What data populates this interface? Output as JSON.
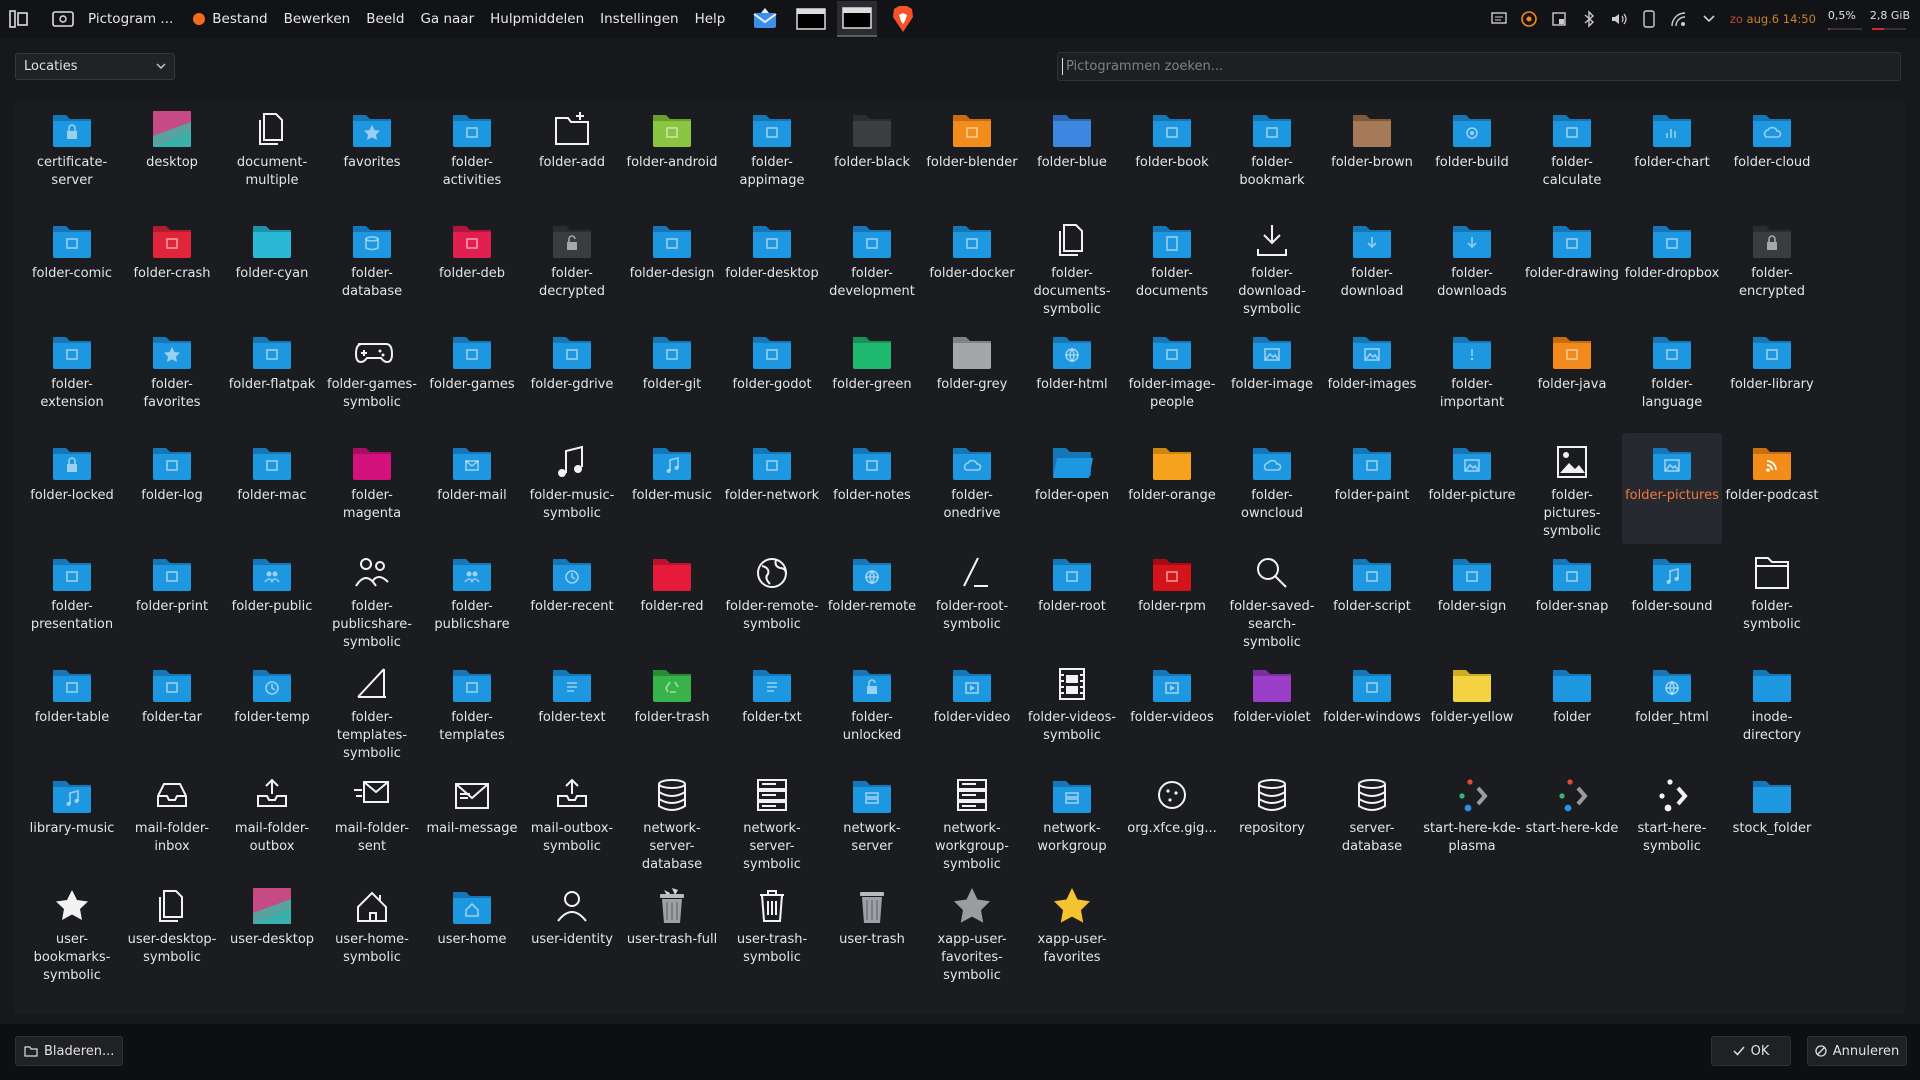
{
  "colors": {
    "folder_blue": "#1d97e0",
    "folder_blue_tab": "#1577b8",
    "accent": "#f2773a",
    "panel": "#121316",
    "dialog": "#16181c"
  },
  "topbar": {
    "app_title": "Pictogram ...",
    "menus": [
      "Bestand",
      "Bewerken",
      "Beeld",
      "Ga naar",
      "Hulpmiddelen",
      "Instellingen",
      "Help"
    ],
    "clock": {
      "prefix": "zo",
      "date_time": "aug.6 14:50"
    },
    "stats": {
      "cpu": "0,5%",
      "mem": "2,8 GiB",
      "cpu_fraction": 0.005,
      "mem_fraction": 0.35
    },
    "tray_icons": [
      "notes-icon",
      "updates-icon",
      "clipboard-icon",
      "bluetooth-icon",
      "volume-icon",
      "phone-icon",
      "network-icon",
      "expand-icon"
    ]
  },
  "dialog": {
    "locations_label": "Locaties",
    "search_placeholder": "Pictogrammen zoeken...",
    "browse_label": "Bladeren...",
    "ok_label": "OK",
    "cancel_label": "Annuleren"
  },
  "icons": [
    {
      "name": "certificate-server",
      "type": "folder",
      "glyph": "lock"
    },
    {
      "name": "desktop",
      "type": "desktop"
    },
    {
      "name": "document-multiple",
      "type": "mono",
      "glyph": "docs"
    },
    {
      "name": "favorites",
      "type": "folder",
      "glyph": "star"
    },
    {
      "name": "folder-activities",
      "type": "folder",
      "glyph": "act"
    },
    {
      "name": "folder-add",
      "type": "mono",
      "glyph": "folderadd"
    },
    {
      "name": "folder-android",
      "type": "folder",
      "color": "#8ac541",
      "tab": "#6c9e2f",
      "glyph": "android"
    },
    {
      "name": "folder-appimage",
      "type": "folder",
      "glyph": "app"
    },
    {
      "name": "folder-black",
      "type": "folder",
      "color": "#3b3d41",
      "tab": "#2b2d31"
    },
    {
      "name": "folder-blender",
      "type": "folder",
      "color": "#f28d1c",
      "tab": "#c86e10",
      "glyph": "blender"
    },
    {
      "name": "folder-blue",
      "type": "folder",
      "color": "#3d87e0",
      "tab": "#2b69b8"
    },
    {
      "name": "folder-book",
      "type": "folder",
      "glyph": "book"
    },
    {
      "name": "folder-bookmark",
      "type": "folder",
      "glyph": "bookmark"
    },
    {
      "name": "folder-brown",
      "type": "folder",
      "color": "#a47a58",
      "tab": "#80593d"
    },
    {
      "name": "folder-build",
      "type": "folder",
      "glyph": "gear"
    },
    {
      "name": "folder-calculate",
      "type": "folder",
      "glyph": "calc"
    },
    {
      "name": "folder-chart",
      "type": "folder",
      "glyph": "chart"
    },
    {
      "name": "folder-cloud",
      "type": "folder",
      "glyph": "cloud"
    },
    {
      "name": "folder-comic",
      "type": "folder",
      "glyph": "comic"
    },
    {
      "name": "folder-crash",
      "type": "folder",
      "color": "#e0253b",
      "tab": "#b31b2e",
      "glyph": "crash"
    },
    {
      "name": "folder-cyan",
      "type": "folder",
      "color": "#29b9d6",
      "tab": "#1c93ac"
    },
    {
      "name": "folder-database",
      "type": "folder",
      "glyph": "db"
    },
    {
      "name": "folder-deb",
      "type": "folder",
      "color": "#e01e4f",
      "tab": "#b0163c",
      "glyph": "deb"
    },
    {
      "name": "folder-decrypted",
      "type": "folder",
      "color": "#3a3c40",
      "tab": "#2a2c30",
      "glyph": "unlock"
    },
    {
      "name": "folder-design",
      "type": "folder",
      "glyph": "design"
    },
    {
      "name": "folder-desktop",
      "type": "folder",
      "glyph": "monitor"
    },
    {
      "name": "folder-development",
      "type": "folder",
      "glyph": "code"
    },
    {
      "name": "folder-docker",
      "type": "folder",
      "glyph": "docker"
    },
    {
      "name": "folder-documents-symbolic",
      "type": "mono",
      "glyph": "docs"
    },
    {
      "name": "folder-documents",
      "type": "folder",
      "glyph": "doc"
    },
    {
      "name": "folder-download-symbolic",
      "type": "mono",
      "glyph": "download"
    },
    {
      "name": "folder-download",
      "type": "folder",
      "glyph": "download"
    },
    {
      "name": "folder-downloads",
      "type": "folder",
      "glyph": "download"
    },
    {
      "name": "folder-drawing",
      "type": "folder",
      "glyph": "drawing"
    },
    {
      "name": "folder-dropbox",
      "type": "folder",
      "glyph": "dropbox"
    },
    {
      "name": "folder-encrypted",
      "type": "folder",
      "color": "#3a3c40",
      "tab": "#2a2c30",
      "glyph": "lock"
    },
    {
      "name": "folder-extension",
      "type": "folder",
      "glyph": "ext"
    },
    {
      "name": "folder-favorites",
      "type": "folder",
      "glyph": "star"
    },
    {
      "name": "folder-flatpak",
      "type": "folder",
      "glyph": "box"
    },
    {
      "name": "folder-games-symbolic",
      "type": "mono",
      "glyph": "gamepad"
    },
    {
      "name": "folder-games",
      "type": "folder",
      "glyph": "gamepad"
    },
    {
      "name": "folder-gdrive",
      "type": "folder",
      "glyph": "gdrive"
    },
    {
      "name": "folder-git",
      "type": "folder",
      "glyph": "git"
    },
    {
      "name": "folder-godot",
      "type": "folder",
      "glyph": "godot"
    },
    {
      "name": "folder-green",
      "type": "folder",
      "color": "#1fb86f",
      "tab": "#16925a"
    },
    {
      "name": "folder-grey",
      "type": "folder",
      "color": "#a4a6aa",
      "tab": "#808286"
    },
    {
      "name": "folder-html",
      "type": "folder",
      "glyph": "globe"
    },
    {
      "name": "folder-image-people",
      "type": "folder",
      "glyph": "person"
    },
    {
      "name": "folder-image",
      "type": "folder",
      "glyph": "image"
    },
    {
      "name": "folder-images",
      "type": "folder",
      "glyph": "image"
    },
    {
      "name": "folder-important",
      "type": "folder",
      "glyph": "excl"
    },
    {
      "name": "folder-java",
      "type": "folder",
      "color": "#f28a1c",
      "tab": "#c76b0e",
      "glyph": "java"
    },
    {
      "name": "folder-language",
      "type": "folder",
      "glyph": "lang"
    },
    {
      "name": "folder-library",
      "type": "folder",
      "glyph": "library"
    },
    {
      "name": "folder-locked",
      "type": "folder",
      "glyph": "lock"
    },
    {
      "name": "folder-log",
      "type": "folder",
      "glyph": "log"
    },
    {
      "name": "folder-mac",
      "type": "folder",
      "glyph": "mac"
    },
    {
      "name": "folder-magenta",
      "type": "folder",
      "color": "#d4127e",
      "tab": "#a80c63"
    },
    {
      "name": "folder-mail",
      "type": "folder",
      "glyph": "mail"
    },
    {
      "name": "folder-music-symbolic",
      "type": "mono",
      "glyph": "music"
    },
    {
      "name": "folder-music",
      "type": "folder",
      "glyph": "music"
    },
    {
      "name": "folder-network",
      "type": "folder",
      "glyph": "net"
    },
    {
      "name": "folder-notes",
      "type": "folder",
      "glyph": "notes"
    },
    {
      "name": "folder-onedrive",
      "type": "folder",
      "glyph": "cloud"
    },
    {
      "name": "folder-open",
      "type": "folderopen",
      "color": "#1d97e0"
    },
    {
      "name": "folder-orange",
      "type": "folder",
      "color": "#f7a21e",
      "tab": "#cf8410"
    },
    {
      "name": "folder-owncloud",
      "type": "folder",
      "glyph": "cloud"
    },
    {
      "name": "folder-paint",
      "type": "folder",
      "glyph": "paint"
    },
    {
      "name": "folder-picture",
      "type": "folder",
      "glyph": "image"
    },
    {
      "name": "folder-pictures-symbolic",
      "type": "mono",
      "glyph": "picture"
    },
    {
      "name": "folder-pictures",
      "type": "folder",
      "glyph": "image",
      "selected": true
    },
    {
      "name": "folder-podcast",
      "type": "folder",
      "color": "#f28d1c",
      "tab": "#c86e10",
      "glyph": "rss"
    },
    {
      "name": "folder-presentation",
      "type": "folder",
      "glyph": "pres"
    },
    {
      "name": "folder-print",
      "type": "folder",
      "glyph": "print"
    },
    {
      "name": "folder-public",
      "type": "folder",
      "glyph": "people"
    },
    {
      "name": "folder-publicshare-symbolic",
      "type": "mono",
      "glyph": "people"
    },
    {
      "name": "folder-publicshare",
      "type": "folder",
      "glyph": "people"
    },
    {
      "name": "folder-recent",
      "type": "folder",
      "glyph": "clock"
    },
    {
      "name": "folder-red",
      "type": "folder",
      "color": "#e61a3a",
      "tab": "#b8122c"
    },
    {
      "name": "folder-remote-symbolic",
      "type": "mono",
      "glyph": "globe"
    },
    {
      "name": "folder-remote",
      "type": "folder",
      "glyph": "globe"
    },
    {
      "name": "folder-root-symbolic",
      "type": "mono",
      "glyph": "root"
    },
    {
      "name": "folder-root",
      "type": "folder",
      "glyph": "root"
    },
    {
      "name": "folder-rpm",
      "type": "folder",
      "color": "#d4131a",
      "tab": "#a80c12",
      "glyph": "rpm"
    },
    {
      "name": "folder-saved-search-symbolic",
      "type": "mono",
      "glyph": "search"
    },
    {
      "name": "folder-script",
      "type": "folder",
      "glyph": "script"
    },
    {
      "name": "folder-sign",
      "type": "folder",
      "glyph": "sign"
    },
    {
      "name": "folder-snap",
      "type": "folder",
      "glyph": "snap"
    },
    {
      "name": "folder-sound",
      "type": "folder",
      "glyph": "music"
    },
    {
      "name": "folder-symbolic",
      "type": "mono",
      "glyph": "folder"
    },
    {
      "name": "folder-table",
      "type": "folder",
      "glyph": "table"
    },
    {
      "name": "folder-tar",
      "type": "folder",
      "glyph": "tar"
    },
    {
      "name": "folder-temp",
      "type": "folder",
      "glyph": "clock"
    },
    {
      "name": "folder-templates-symbolic",
      "type": "mono",
      "glyph": "template"
    },
    {
      "name": "folder-templates",
      "type": "folder",
      "glyph": "template"
    },
    {
      "name": "folder-text",
      "type": "folder",
      "glyph": "text"
    },
    {
      "name": "folder-trash",
      "type": "folder",
      "color": "#37b34a",
      "tab": "#278c36",
      "glyph": "recycle"
    },
    {
      "name": "folder-txt",
      "type": "folder",
      "glyph": "text"
    },
    {
      "name": "folder-unlocked",
      "type": "folder",
      "glyph": "unlock"
    },
    {
      "name": "folder-video",
      "type": "folder",
      "glyph": "video"
    },
    {
      "name": "folder-videos-symbolic",
      "type": "mono",
      "glyph": "film"
    },
    {
      "name": "folder-videos",
      "type": "folder",
      "glyph": "video"
    },
    {
      "name": "folder-violet",
      "type": "folder",
      "color": "#9b3fc8",
      "tab": "#7a2ea0"
    },
    {
      "name": "folder-windows",
      "type": "folder",
      "glyph": "windows"
    },
    {
      "name": "folder-yellow",
      "type": "folder",
      "color": "#f5d23f",
      "tab": "#cfac24"
    },
    {
      "name": "folder",
      "type": "folder"
    },
    {
      "name": "folder_html",
      "type": "folder",
      "glyph": "globe"
    },
    {
      "name": "inode-directory",
      "type": "folder"
    },
    {
      "name": "library-music",
      "type": "folder",
      "glyph": "music"
    },
    {
      "name": "mail-folder-inbox",
      "type": "mono",
      "glyph": "inbox"
    },
    {
      "name": "mail-folder-outbox",
      "type": "mono",
      "glyph": "outbox"
    },
    {
      "name": "mail-folder-sent",
      "type": "mono",
      "glyph": "sent"
    },
    {
      "name": "mail-message",
      "type": "mono",
      "glyph": "envelope"
    },
    {
      "name": "mail-outbox-symbolic",
      "type": "mono",
      "glyph": "outbox"
    },
    {
      "name": "network-server-database",
      "type": "mono",
      "glyph": "db"
    },
    {
      "name": "network-server-symbolic",
      "type": "mono",
      "glyph": "server"
    },
    {
      "name": "network-server",
      "type": "folder",
      "glyph": "server"
    },
    {
      "name": "network-workgroup-symbolic",
      "type": "mono",
      "glyph": "server"
    },
    {
      "name": "network-workgroup",
      "type": "folder",
      "glyph": "server"
    },
    {
      "name": "org.xfce.gig...",
      "type": "mono",
      "glyph": "gigolo"
    },
    {
      "name": "repository",
      "type": "mono",
      "glyph": "db"
    },
    {
      "name": "server-database",
      "type": "mono",
      "glyph": "db"
    },
    {
      "name": "start-here-kde-plasma",
      "type": "kde"
    },
    {
      "name": "start-here-kde",
      "type": "kde"
    },
    {
      "name": "start-here-symbolic",
      "type": "kdemono"
    },
    {
      "name": "stock_folder",
      "type": "folder"
    },
    {
      "name": "user-bookmarks-symbolic",
      "type": "mono",
      "glyph": "star"
    },
    {
      "name": "user-desktop-symbolic",
      "type": "mono",
      "glyph": "docs"
    },
    {
      "name": "user-desktop",
      "type": "desktop"
    },
    {
      "name": "user-home-symbolic",
      "type": "mono",
      "glyph": "home"
    },
    {
      "name": "user-home",
      "type": "folder",
      "glyph": "home"
    },
    {
      "name": "user-identity",
      "type": "mono",
      "glyph": "user"
    },
    {
      "name": "user-trash-full",
      "type": "trashfull"
    },
    {
      "name": "user-trash-symbolic",
      "type": "mono",
      "glyph": "trash"
    },
    {
      "name": "user-trash",
      "type": "trash"
    },
    {
      "name": "xapp-user-favorites-symbolic",
      "type": "bigstar",
      "color": "#9a9ca0"
    },
    {
      "name": "xapp-user-favorites",
      "type": "bigstar",
      "color": "#f6c330"
    }
  ]
}
